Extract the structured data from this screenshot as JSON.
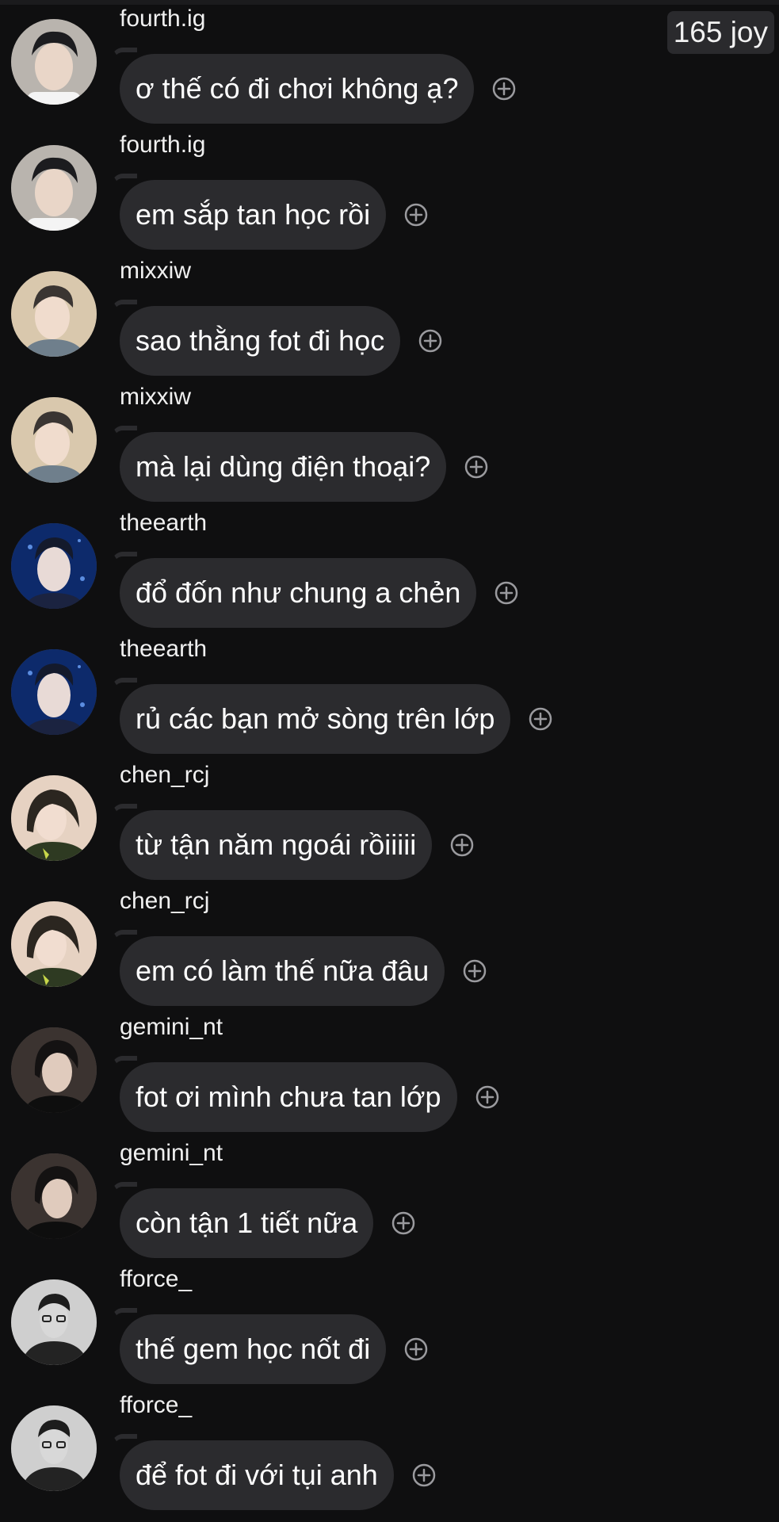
{
  "header": {
    "joy_count": "165 joy"
  },
  "colors": {
    "background": "#0f0f10",
    "bubble": "#2b2b2e",
    "text": "#ffffff",
    "react_icon": "#9a9a9e"
  },
  "messages": [
    {
      "username": "fourth.ig",
      "text": "ơ thế có đi chơi không ạ?",
      "avatar": "avatar-fourth"
    },
    {
      "username": "fourth.ig",
      "text": "em sắp tan học rồi",
      "avatar": "avatar-fourth"
    },
    {
      "username": "mixxiw",
      "text": "sao thằng fot đi học",
      "avatar": "avatar-mixxiw"
    },
    {
      "username": "mixxiw",
      "text": "mà lại dùng điện thoại?",
      "avatar": "avatar-mixxiw"
    },
    {
      "username": "theearth",
      "text": "đổ đốn như chung a chẻn",
      "avatar": "avatar-theearth"
    },
    {
      "username": "theearth",
      "text": "rủ các bạn mở sòng trên lớp",
      "avatar": "avatar-theearth"
    },
    {
      "username": "chen_rcj",
      "text": "từ tận năm ngoái rồiiiii",
      "avatar": "avatar-chen"
    },
    {
      "username": "chen_rcj",
      "text": "em có làm thế nữa đâu",
      "avatar": "avatar-chen"
    },
    {
      "username": "gemini_nt",
      "text": "fot ơi mình chưa tan lớp",
      "avatar": "avatar-gemini"
    },
    {
      "username": "gemini_nt",
      "text": "còn tận 1 tiết nữa",
      "avatar": "avatar-gemini"
    },
    {
      "username": "fforce_",
      "text": "thế gem học nốt đi",
      "avatar": "avatar-fforce"
    },
    {
      "username": "fforce_",
      "text": "để fot đi với tụi anh",
      "avatar": "avatar-fforce"
    }
  ]
}
